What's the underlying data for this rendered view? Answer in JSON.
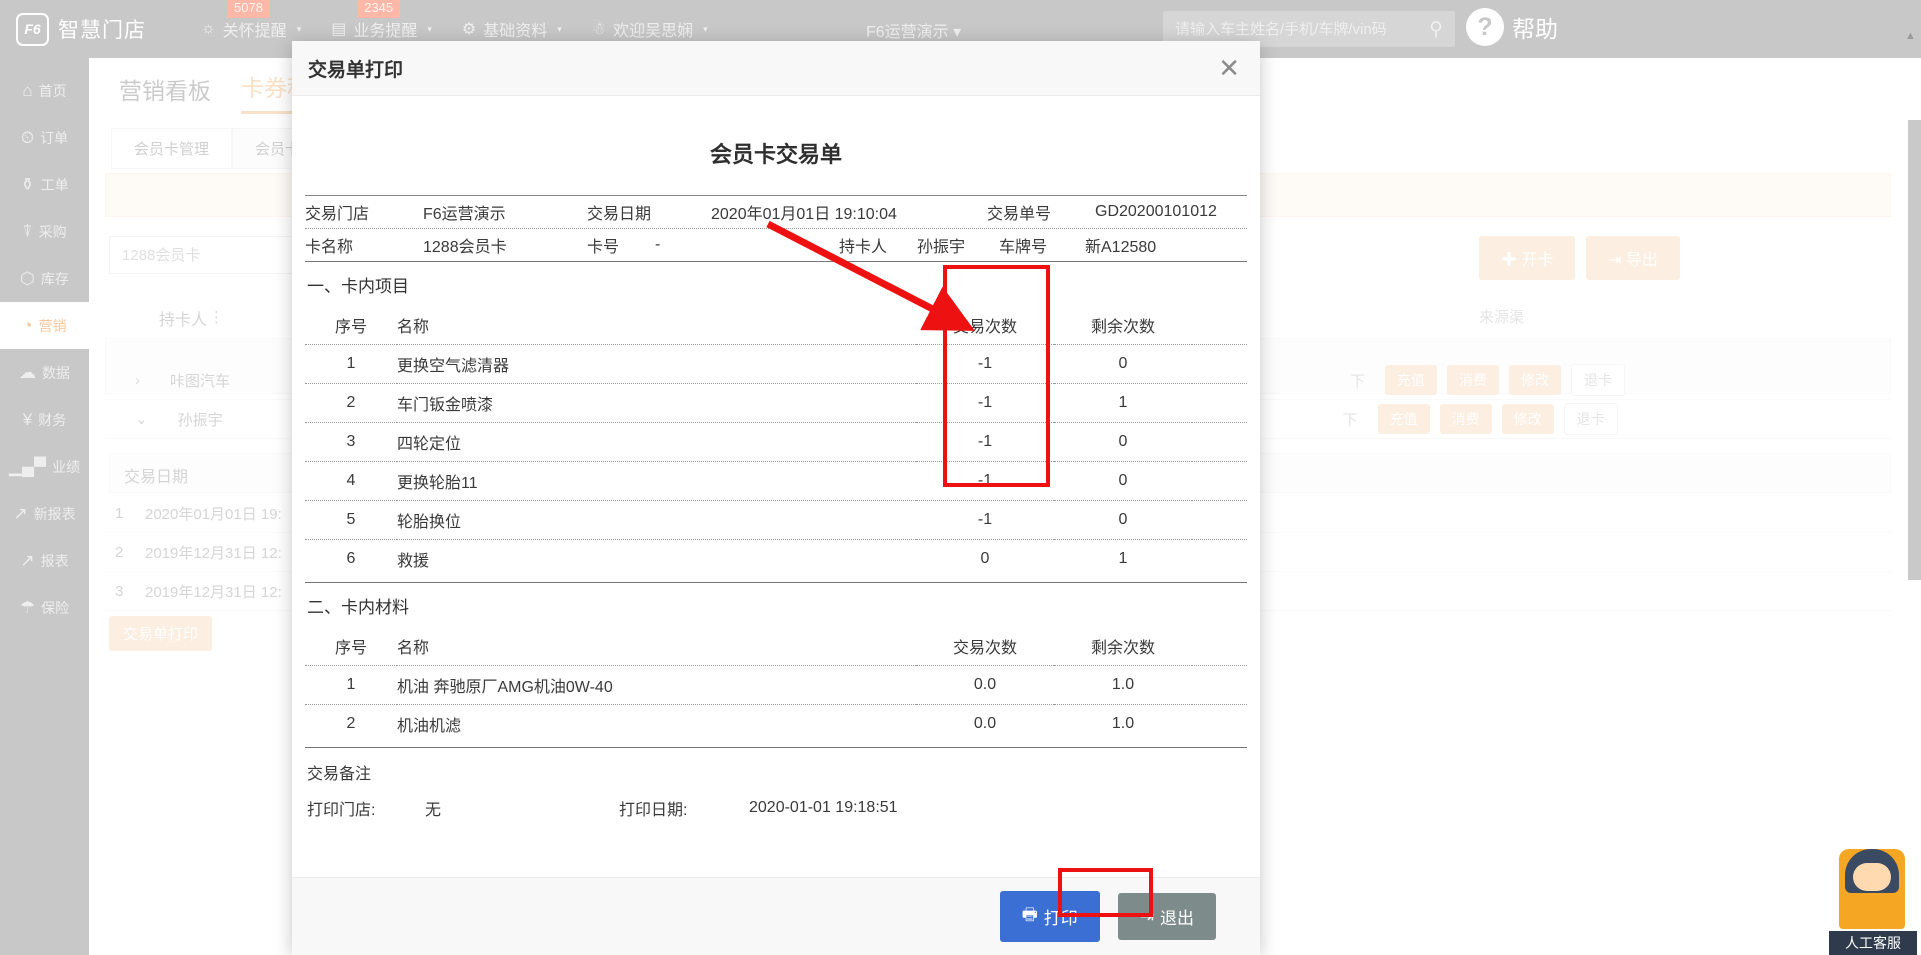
{
  "topbar": {
    "logo_text": "智慧门店",
    "logo_mark": "F6",
    "nav": [
      {
        "icon": "bell-icon",
        "label": "关怀提醒",
        "badge": "5078",
        "caret": "▾"
      },
      {
        "icon": "list-icon",
        "label": "业务提醒",
        "badge": "2345",
        "caret": "▾"
      },
      {
        "icon": "gear-icon",
        "label": "基础资料",
        "badge": "",
        "caret": "▾"
      },
      {
        "icon": "user-icon",
        "label": "欢迎吴思娴",
        "badge": "",
        "caret": "▾"
      }
    ],
    "store_selector": "F6运营演示 ▾",
    "search_placeholder": "请输入车主姓名/手机/车牌/vin码",
    "search_value": "",
    "search_icon": "search-icon",
    "help_label": "帮助",
    "help_icon": "question-mark-icon"
  },
  "sidebar": {
    "items": [
      {
        "icon": "home-icon",
        "glyph": "⌂",
        "label": "首页",
        "active": false
      },
      {
        "icon": "clock-icon",
        "glyph": "◷",
        "label": "订单",
        "active": false
      },
      {
        "icon": "wrench-icon",
        "glyph": "🔧",
        "label": "工单",
        "active": false
      },
      {
        "icon": "cart-icon",
        "glyph": "🛒",
        "label": "采购",
        "active": false
      },
      {
        "icon": "box-icon",
        "glyph": "⬡",
        "label": "库存",
        "active": false
      },
      {
        "icon": "pie-chart-icon",
        "glyph": "◔",
        "label": "营销",
        "active": true
      },
      {
        "icon": "cloud-icon",
        "glyph": "☁",
        "label": "数据",
        "active": false
      },
      {
        "icon": "yuan-icon",
        "glyph": "¥",
        "label": "财务",
        "active": false
      },
      {
        "icon": "bar-chart-icon",
        "glyph": "📊",
        "label": "业绩",
        "active": false
      },
      {
        "icon": "line-chart-icon",
        "glyph": "📈",
        "label": "新报表",
        "active": false
      },
      {
        "icon": "line-chart-icon",
        "glyph": "📈",
        "label": "报表",
        "active": false
      },
      {
        "icon": "umbrella-icon",
        "glyph": "☂",
        "label": "保险",
        "active": false
      }
    ]
  },
  "page": {
    "tabs": [
      {
        "label": "营销看板",
        "selected": false
      },
      {
        "label": "卡券积分",
        "selected": true
      }
    ],
    "sub_tabs": [
      {
        "label": "会员卡管理",
        "selected": true
      },
      {
        "label": "会员卡订",
        "selected": false
      }
    ],
    "search_placeholder": "1288会员卡",
    "btn_open_card": "开卡",
    "btn_export": "导出",
    "col_holder": "持卡人",
    "col_source": "来源渠",
    "col_date": "交易日期",
    "rows": [
      {
        "name": "咔图汽车",
        "date": ""
      },
      {
        "name": "孙振宇",
        "date": ""
      }
    ],
    "tx_rows": [
      {
        "no": "1",
        "date": "2020年01月01日 19:"
      },
      {
        "no": "2",
        "date": "2019年12月31日 12:"
      },
      {
        "no": "3",
        "date": "2019年12月31日 12:"
      }
    ],
    "row_actions": [
      "充值",
      "消费",
      "修改",
      "退卡"
    ],
    "print_btn_bg": "交易单打印",
    "cell_dash": "下"
  },
  "modal": {
    "title": "交易单打印",
    "close_icon": "close-icon",
    "doc_title": "会员卡交易单",
    "info": {
      "store_label": "交易门店",
      "store_value": "F6运营演示",
      "date_label": "交易日期",
      "date_value": "2020年01月01日 19:10:04",
      "order_label": "交易单号",
      "order_value": "GD20200101012",
      "card_name_label": "卡名称",
      "card_name_value": "1288会员卡",
      "card_no_label": "卡号",
      "card_no_value": "-",
      "holder_label": "持卡人",
      "holder_value": "孙振宇",
      "plate_label": "车牌号",
      "plate_value": "新A12580"
    },
    "section_items": {
      "title": "一、卡内项目",
      "columns": [
        "序号",
        "名称",
        "交易次数",
        "剩余次数"
      ],
      "rows": [
        {
          "seq": "1",
          "name": "更换空气滤清器",
          "tx": "-1",
          "remain": "0"
        },
        {
          "seq": "2",
          "name": "车门钣金喷漆",
          "tx": "-1",
          "remain": "1"
        },
        {
          "seq": "3",
          "name": "四轮定位",
          "tx": "-1",
          "remain": "0"
        },
        {
          "seq": "4",
          "name": "更换轮胎11",
          "tx": "-1",
          "remain": "0"
        },
        {
          "seq": "5",
          "name": "轮胎换位",
          "tx": "-1",
          "remain": "0"
        },
        {
          "seq": "6",
          "name": "救援",
          "tx": "0",
          "remain": "1"
        }
      ]
    },
    "section_materials": {
      "title": "二、卡内材料",
      "columns": [
        "序号",
        "名称",
        "交易次数",
        "剩余次数"
      ],
      "rows": [
        {
          "seq": "1",
          "name": "机油 奔驰原厂AMG机油0W-40",
          "tx": "0.0",
          "remain": "1.0"
        },
        {
          "seq": "2",
          "name": "机油机滤",
          "tx": "0.0",
          "remain": "1.0"
        }
      ]
    },
    "footer_notes": {
      "remark_label": "交易备注",
      "print_store_label": "打印门店:",
      "print_store_value": "无",
      "print_date_label": "打印日期:",
      "print_date_value": "2020-01-01 19:18:51"
    },
    "buttons": {
      "print_label": "打印",
      "print_icon": "printer-icon",
      "exit_label": "退出",
      "exit_icon": "exit-icon"
    }
  },
  "customer_service": {
    "label": "人工客服"
  },
  "annotations": {
    "highlight_color": "#ee1111",
    "arrow": "diagonal-arrow-to-transaction-count-column",
    "box_column": "交易次数",
    "box_button": "打印"
  }
}
